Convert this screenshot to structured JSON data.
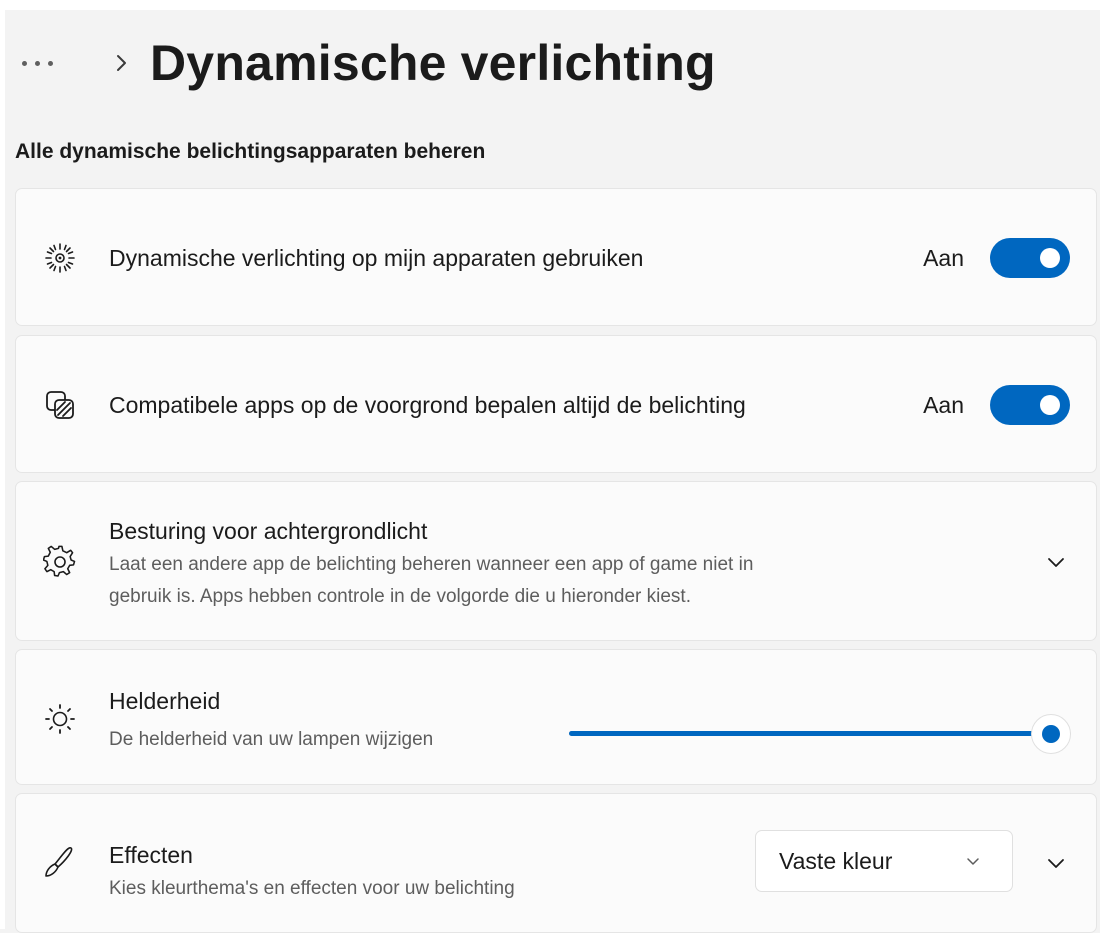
{
  "header": {
    "more_icon": "more-dots-icon",
    "chevron_icon": "chevron-right-icon",
    "title": "Dynamische verlichting"
  },
  "section": {
    "title": "Alle dynamische belichtingsapparaten beheren"
  },
  "settings": {
    "use_dynamic_lighting": {
      "icon": "lighting-icon",
      "label": "Dynamische verlichting op mijn apparaten gebruiken",
      "state": "Aan",
      "on": true
    },
    "compatible_apps": {
      "icon": "apps-lighting-icon",
      "label": "Compatibele apps op de voorgrond bepalen altijd de belichting",
      "state": "Aan",
      "on": true
    },
    "background_control": {
      "icon": "gear-icon",
      "label": "Besturing voor achtergrondlicht",
      "desc_line1": "Laat een andere app de belichting beheren wanneer een app of game niet in",
      "desc_line2": "gebruik is. Apps hebben controle in de volgorde die u hieronder kiest."
    },
    "brightness": {
      "icon": "brightness-icon",
      "label": "Helderheid",
      "desc": "De helderheid van uw lampen wijzigen",
      "value_percent": 100
    },
    "effects": {
      "icon": "brush-icon",
      "label": "Effecten",
      "desc": "Kies kleurthema's en effecten voor uw belichting",
      "selected": "Vaste kleur"
    }
  },
  "colors": {
    "accent": "#0067c0",
    "background": "#f3f3f3",
    "card": "#fbfbfb"
  }
}
